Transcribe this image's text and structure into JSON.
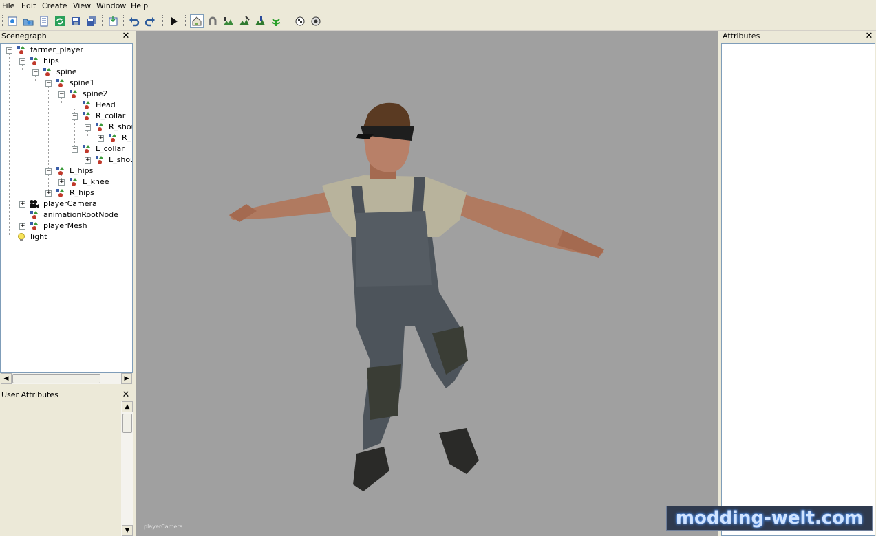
{
  "menu": [
    "File",
    "Edit",
    "Create",
    "View",
    "Window",
    "Help"
  ],
  "panels": {
    "scenegraph_title": "Scenegraph",
    "user_attributes_title": "User Attributes",
    "attributes_title": "Attributes"
  },
  "tree": [
    {
      "label": "farmer_player"
    },
    {
      "label": "hips"
    },
    {
      "label": "spine"
    },
    {
      "label": "spine1"
    },
    {
      "label": "spine2"
    },
    {
      "label": "Head"
    },
    {
      "label": "R_collar"
    },
    {
      "label": "R_shou"
    },
    {
      "label": "R_"
    },
    {
      "label": "L_collar"
    },
    {
      "label": "L_shou"
    },
    {
      "label": "L_hips"
    },
    {
      "label": "L_knee"
    },
    {
      "label": "R_hips"
    },
    {
      "label": "playerCamera"
    },
    {
      "label": "animationRootNode"
    },
    {
      "label": "playerMesh"
    },
    {
      "label": "light"
    }
  ],
  "viewport": {
    "camera_label": "playerCamera"
  },
  "watermark": "modding-welt.com",
  "icons": {
    "toolbar": [
      "new-scene-icon",
      "open-icon",
      "list-icon",
      "refresh-icon",
      "save-icon",
      "save-all-icon",
      "import-icon",
      "undo-icon",
      "redo-icon",
      "play-icon",
      "home-icon",
      "magnet-icon",
      "terrain-icon",
      "terrain-edit-icon",
      "terrain-paint-icon",
      "foliage-icon",
      "checker-icon",
      "settings-icon"
    ]
  },
  "colors": {
    "viewport_bg": "#a0a0a0",
    "panel_bg": "#ece9d8"
  }
}
